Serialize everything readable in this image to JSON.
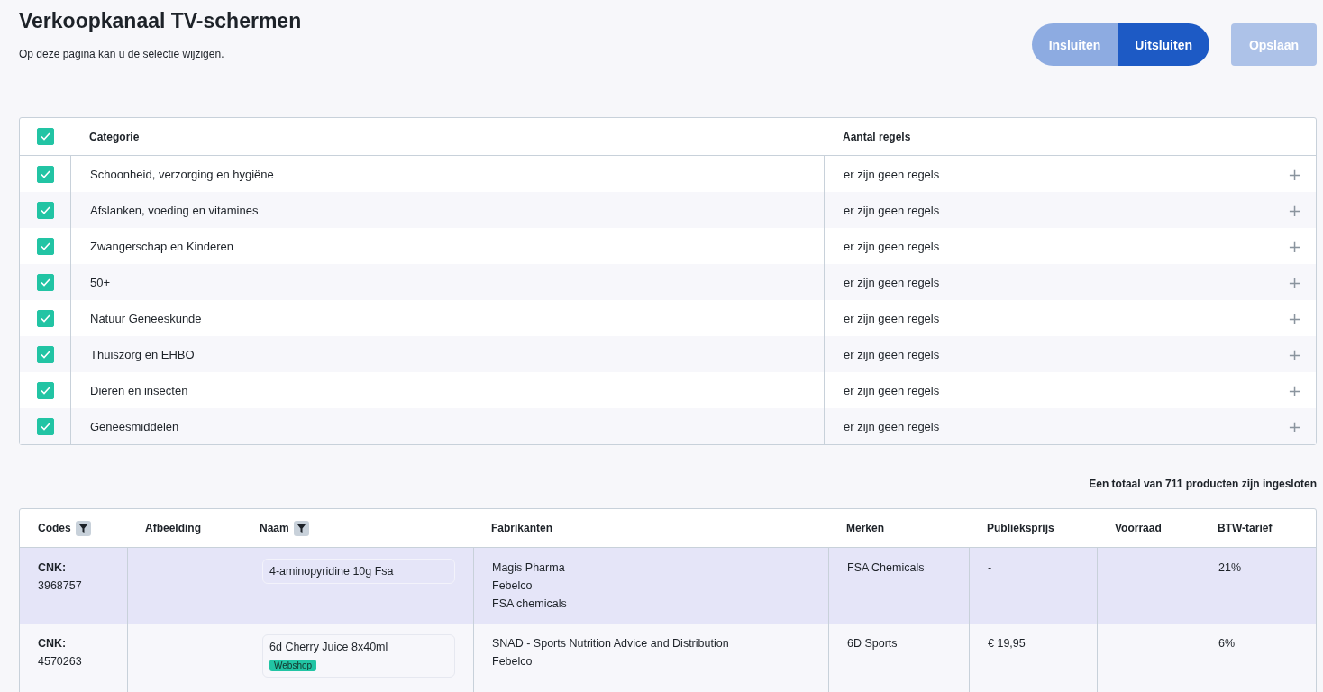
{
  "header": {
    "title": "Verkoopkanaal TV-schermen",
    "subtitle": "Op deze pagina kan u de selectie wijzigen."
  },
  "mode_toggle": [
    {
      "label": "Insluiten",
      "selected": false
    },
    {
      "label": "Uitsluiten",
      "selected": true
    }
  ],
  "save_button": {
    "label": "Opslaan",
    "disabled": true
  },
  "category_table": {
    "all_checked": true,
    "columns": [
      "Categorie",
      "Aantal regels"
    ],
    "rows": [
      {
        "name": "Schoonheid, verzorging en hygiëne",
        "rules": "er zijn geen regels",
        "checked": true,
        "action": "+"
      },
      {
        "name": "Afslanken, voeding en vitamines",
        "rules": "er zijn geen regels",
        "checked": true,
        "action": "+"
      },
      {
        "name": "Zwangerschap en Kinderen",
        "rules": "er zijn geen regels",
        "checked": true,
        "action": "+"
      },
      {
        "name": "50+",
        "rules": "er zijn geen regels",
        "checked": true,
        "action": "+"
      },
      {
        "name": "Natuur Geneeskunde",
        "rules": "er zijn geen regels",
        "checked": true,
        "action": "+"
      },
      {
        "name": "Thuiszorg en EHBO",
        "rules": "er zijn geen regels",
        "checked": true,
        "action": "+"
      },
      {
        "name": "Dieren en insecten",
        "rules": "er zijn geen regels",
        "checked": true,
        "action": "+"
      },
      {
        "name": "Geneesmiddelen",
        "rules": "er zijn geen regels",
        "checked": true,
        "action": "+"
      }
    ]
  },
  "total_text": "Een totaal van 711 producten zijn ingesloten",
  "product_table": {
    "columns": [
      {
        "label": "Codes",
        "filter": true
      },
      {
        "label": "Afbeelding",
        "filter": false
      },
      {
        "label": "Naam",
        "filter": true
      },
      {
        "label": "Fabrikanten",
        "filter": false
      },
      {
        "label": "Merken",
        "filter": false
      },
      {
        "label": "Publieksprijs",
        "filter": false
      },
      {
        "label": "Voorraad",
        "filter": false
      },
      {
        "label": "BTW-tarief",
        "filter": false
      }
    ],
    "rows": [
      {
        "selected": true,
        "code_label": "CNK:",
        "code": "3968757",
        "name": "4-aminopyridine 10g Fsa",
        "tags": [],
        "manufacturers": [
          "Magis Pharma",
          "Febelco",
          "FSA chemicals"
        ],
        "brand": "FSA Chemicals",
        "price": "-",
        "vat": "21%"
      },
      {
        "selected": false,
        "code_label": "CNK:",
        "code": "4570263",
        "name": "6d Cherry Juice 8x40ml",
        "tags": [
          "Webshop"
        ],
        "manufacturers": [
          "SNAD - Sports Nutrition Advice and Distribution",
          "Febelco"
        ],
        "brand": "6D Sports",
        "price": "€ 19,95",
        "vat": "6%"
      }
    ]
  }
}
